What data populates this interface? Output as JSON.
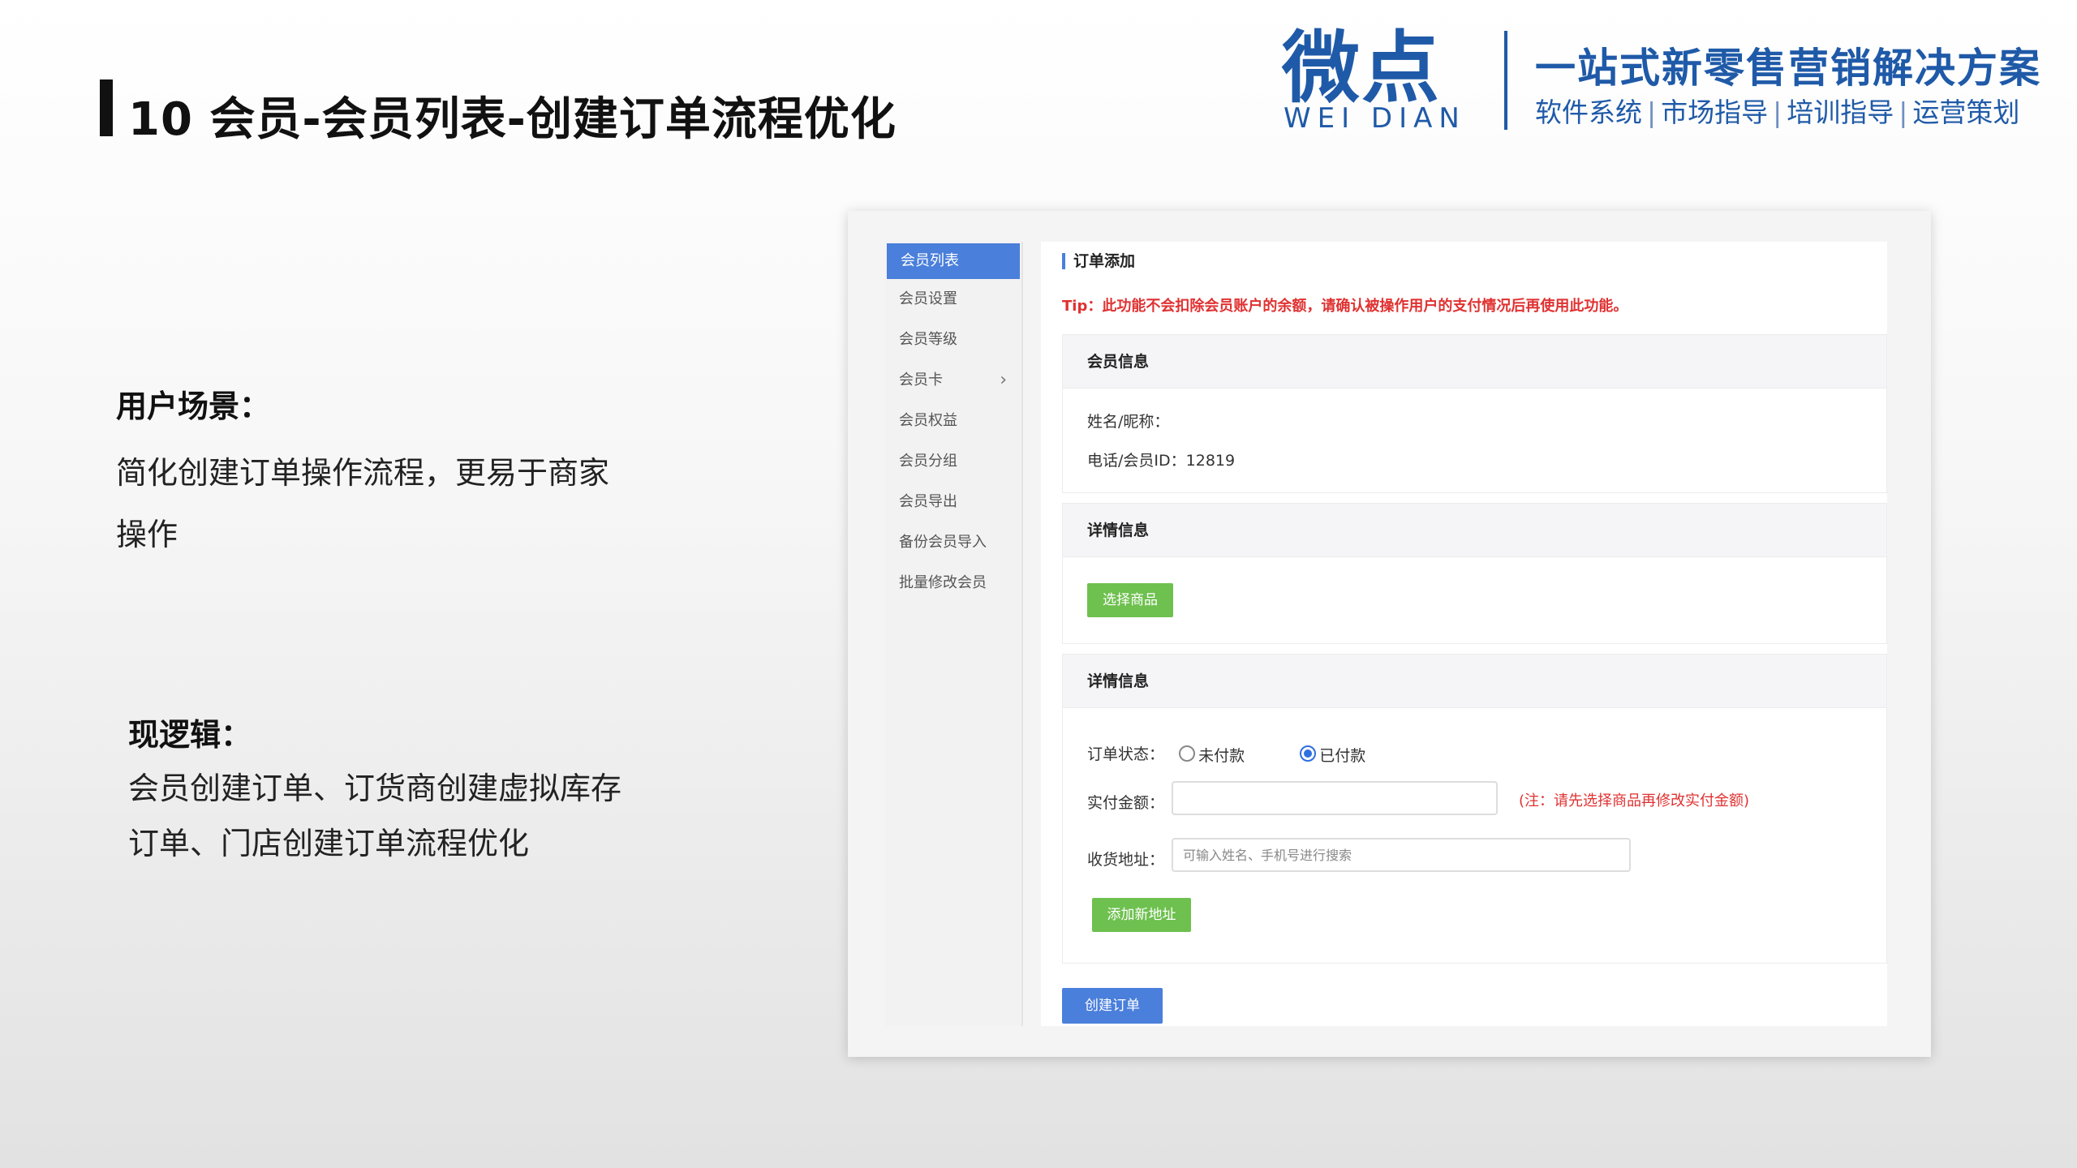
{
  "slide": {
    "title": "10 会员-会员列表-创建订单流程优化"
  },
  "brand": {
    "logo_cn": "微点",
    "logo_en": "WEI DIAN",
    "slogan": "一站式新零售营销解决方案",
    "services": [
      "软件系统",
      "市场指导",
      "培训指导",
      "运营策划"
    ],
    "color": "#1f5aa8"
  },
  "scene": {
    "heading": "用户场景：",
    "body": "简化创建订单操作流程，更易于商家操作"
  },
  "logic": {
    "heading": "现逻辑：",
    "body": "会员创建订单、订货商创建虚拟库存订单、门店创建订单流程优化"
  },
  "app": {
    "sidebar": {
      "items": [
        {
          "label": "会员列表",
          "active": true
        },
        {
          "label": "会员设置"
        },
        {
          "label": "会员等级"
        },
        {
          "label": "会员卡",
          "has_arrow": true
        },
        {
          "label": "会员权益"
        },
        {
          "label": "会员分组"
        },
        {
          "label": "会员导出"
        },
        {
          "label": "备份会员导入"
        },
        {
          "label": "批量修改会员"
        }
      ]
    },
    "content": {
      "title": "订单添加",
      "tip": "Tip：此功能不会扣除会员账户的余额，请确认被操作用户的支付情况后再使用此功能。",
      "member_section": {
        "title": "会员信息",
        "name_label": "姓名/昵称：",
        "name_value": "",
        "phone_label": "电话/会员ID：",
        "phone_value": "12819"
      },
      "detail_section": {
        "title": "详情信息",
        "select_goods_button": "选择商品"
      },
      "detail_section2": {
        "title": "详情信息",
        "status_label": "订单状态：",
        "status_options": [
          "未付款",
          "已付款"
        ],
        "status_selected": "已付款",
        "amount_label": "实付金额：",
        "amount_value": "",
        "amount_note": "(注：请先选择商品再修改实付金额)",
        "address_label": "收货地址：",
        "address_placeholder": "可输入姓名、手机号进行搜索",
        "add_address_button": "添加新地址"
      },
      "create_order_button": "创建订单"
    },
    "colors": {
      "primary": "#4a7fdb",
      "success": "#6ec04f",
      "danger": "#e03131"
    }
  }
}
